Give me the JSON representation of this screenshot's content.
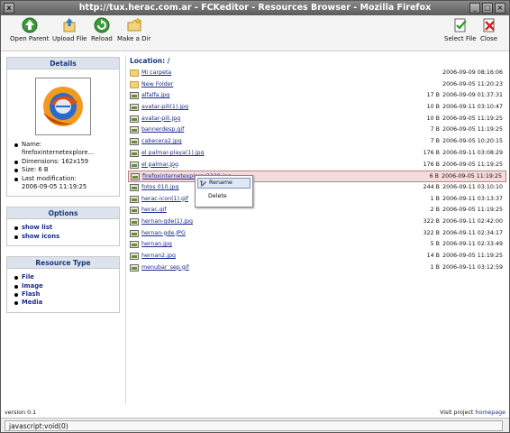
{
  "window": {
    "title": "http://tux.herac.com.ar - FCKeditor - Resources Browser - Mozilla Firefox"
  },
  "toolbar": {
    "items": [
      {
        "label": "Open Parent",
        "icon": "up-arrow-icon"
      },
      {
        "label": "Upload File",
        "icon": "upload-icon"
      },
      {
        "label": "Reload",
        "icon": "reload-icon"
      },
      {
        "label": "Make a Dir",
        "icon": "new-folder-icon"
      },
      {
        "label": "Select File",
        "icon": "select-file-icon"
      },
      {
        "label": "Close",
        "icon": "close-icon"
      }
    ]
  },
  "details": {
    "title": "Details",
    "name_label": "Name:",
    "name_value": "firefoxinternetexplore...",
    "dimensions": "Dimensions: 162x159",
    "size": "Size: 6 B",
    "modified_label": "Last modification:",
    "modified_value": "2006-09-05 11:19:25"
  },
  "options": {
    "title": "Options",
    "items": [
      "show list",
      "show icons"
    ]
  },
  "resource_type": {
    "title": "Resource Type",
    "items": [
      "File",
      "Image",
      "Flash",
      "Media"
    ]
  },
  "location": "Location: /",
  "files": [
    {
      "name": "Mi carpeta",
      "size": "",
      "date": "2006-09-09 08:16:06",
      "type": "folder"
    },
    {
      "name": "New Folder",
      "size": "",
      "date": "2006-09-05 11:20:23",
      "type": "folder"
    },
    {
      "name": "alfalfa.jpg",
      "size": "17 B",
      "date": "2006-09-09 01:37:31",
      "type": "image"
    },
    {
      "name": "avatar-pili(1).jpg",
      "size": "10 B",
      "date": "2006-09-11 03:10:47",
      "type": "image"
    },
    {
      "name": "avatar-pili.jpg",
      "size": "10 B",
      "date": "2006-09-05 11:19:25",
      "type": "image"
    },
    {
      "name": "bannerdesp.gif",
      "size": "7 B",
      "date": "2006-09-05 11:19:25",
      "type": "image"
    },
    {
      "name": "cabecera2.jpg",
      "size": "7 B",
      "date": "2006-09-05 10:20:15",
      "type": "image"
    },
    {
      "name": "el palmar-playa(1).jpg",
      "size": "176 B",
      "date": "2006-09-11 03:08:29",
      "type": "image"
    },
    {
      "name": "el palmar.jpg",
      "size": "176 B",
      "date": "2006-09-05 11:19:25",
      "type": "image"
    },
    {
      "name": "firefoxinternetexplorer3330.jpg",
      "size": "6 B",
      "date": "2006-09-05 11:19:25",
      "type": "image",
      "selected": true
    },
    {
      "name": "fotos 010.jpg",
      "size": "244 B",
      "date": "2006-09-11 03:10:10",
      "type": "image"
    },
    {
      "name": "herac-icon(1).gif",
      "size": "1 B",
      "date": "2006-09-11 03:13:37",
      "type": "image"
    },
    {
      "name": "herac.gif",
      "size": "2 B",
      "date": "2006-09-05 11:19:25",
      "type": "image"
    },
    {
      "name": "hernan-gde(1).jpg",
      "size": "322 B",
      "date": "2006-09-11 02:42:00",
      "type": "image"
    },
    {
      "name": "hernan-gde.JPG",
      "size": "322 B",
      "date": "2006-09-11 02:34:17",
      "type": "image"
    },
    {
      "name": "hernan.jpg",
      "size": "5 B",
      "date": "2006-09-11 02:33:49",
      "type": "image"
    },
    {
      "name": "hernan2.jpg",
      "size": "14 B",
      "date": "2006-09-05 11:19:25",
      "type": "image"
    },
    {
      "name": "menubar_sep.gif",
      "size": "1 B",
      "date": "2006-09-11 03:12:59",
      "type": "image"
    }
  ],
  "context_menu": {
    "items": [
      "Rename",
      "Delete"
    ]
  },
  "footer": {
    "version": "version 0.1",
    "visit_text": "Visit project",
    "visit_link": "homepage"
  },
  "statusbar": {
    "text": "javascript:void(0)"
  }
}
